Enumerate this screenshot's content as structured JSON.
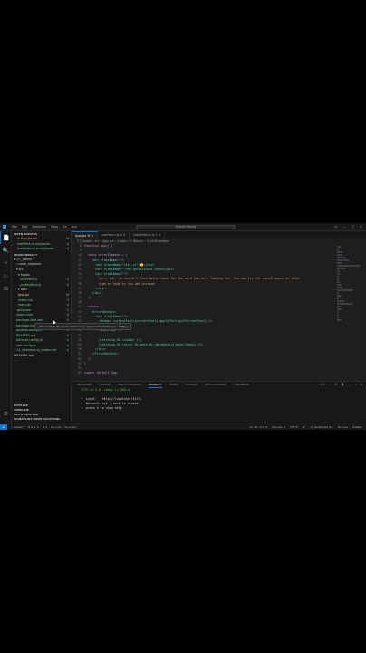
{
  "faint_lines": [
    "App.jsx M",
    "useFetch.js 3 U",
    "useKeybind.js U"
  ],
  "titlebar": {
    "menu": [
      "File",
      "Edit",
      "Selection",
      "View",
      "Go",
      "Run",
      "..."
    ],
    "search": "ShadcnReact",
    "window_controls": [
      "▭",
      "—",
      "□",
      "✕"
    ]
  },
  "activity": [
    "📄",
    "🔍",
    "⑂",
    "▷",
    "⊞",
    "⚙"
  ],
  "sidebar": {
    "open_editors_label": "OPEN EDITORS",
    "open_editors": [
      {
        "name": "✕ App.jsx src",
        "status": "M"
      },
      {
        "name": "useFetch.js src/hooks",
        "status": "U"
      },
      {
        "name": "useKeybind.js src/hooks",
        "status": "U"
      }
    ],
    "project_label": "SHADCNREACT",
    "tree": [
      {
        "name": "▾ 27_hooks",
        "status": ""
      },
      {
        "name": "› node_modules",
        "status": ""
      },
      {
        "name": "▾ src",
        "status": ""
      },
      {
        "name": "▾ hooks",
        "status": ""
      },
      {
        "name": "useFetch.js",
        "status": "U"
      },
      {
        "name": "useKeybind.js",
        "status": "U"
      },
      {
        "name": "▾ utils",
        "status": ""
      },
      {
        "name": "App.jsx",
        "status": "M"
      },
      {
        "name": "index.css",
        "status": "U"
      },
      {
        "name": "main.jsx",
        "status": "U"
      },
      {
        "name": ".gitignore",
        "status": "U"
      },
      {
        "name": "index.html",
        "status": "U"
      },
      {
        "name": "package-lock.json",
        "status": "U"
      },
      {
        "name": "package.json",
        "status": "U"
      },
      {
        "name": "postcss.config.js",
        "status": "U"
      },
      {
        "name": "README.md",
        "status": "U"
      },
      {
        "name": "tailwind.config.js",
        "status": "U"
      },
      {
        "name": "vite.config.js",
        "status": "U"
      },
      {
        "name": "› 11_introducing_hooks.md",
        "status": "U"
      },
      {
        "name": "README.md",
        "status": ""
      }
    ],
    "footer_sections": [
      "OUTLINE",
      "TIMELINE",
      "AUTO REACTOR",
      "SONARLINT ISSUE LOCATIONS"
    ]
  },
  "tabs": [
    {
      "label": "App.jsx M ✕",
      "active": true
    },
    {
      "label": "useFetch.js 3 U",
      "active": false
    },
    {
      "label": "useKeybind.js 1 U",
      "active": false
    }
  ],
  "breadcrumb": "27_hooks › src › App.jsx › ⊙ App › ⊙ Return › ⊙ clickHandler",
  "code_lines": [
    "function App() {",
    "",
    "  const errorElement = (",
    "    <div className=\"\">",
    "      <div className=\"text-xl\">😕</div>",
    "      <div className=\"\">No Definitions Found</div>",
    "      <div className=\"\">",
    "        Sorry pal, we couldn't find definitions for the word you were looking for. You can try the search again at later",
    "        time or head to the web instead.",
    "      </div>",
    "    </div>",
    "  );",
    "",
    "  return (",
    "    <ErrorHandler>",
    "      <div className=\"\">",
    "        <Header currentFont={currentFont} applyFont={setCurrentFont} />",
    "",
    "        <SearchBar />",
    "",
    "        {fetching && <Loader />}",
    "        {fetching && !error && data && <WordResult data={data} />}",
    "      </div>",
    "    </ErrorHandler>",
    "  );",
    "}",
    "",
    "export default App"
  ],
  "line_numbers_start": 8,
  "hover_tooltip": "~/Documents/27_hooks/dictionary-app/src/utils/dictionary-config.js",
  "panel": {
    "tabs": [
      "PROBLEMS",
      "OUTPUT",
      "DEBUG CONSOLE",
      "TERMINAL",
      "PORTS",
      "GITLENS",
      "SEARCH ERROR",
      "COMMENTS"
    ],
    "active_tab": "TERMINAL",
    "controls": [
      "node",
      "+",
      "⊞",
      "🗑",
      "…",
      "^",
      "✕"
    ],
    "lines": [
      "VITE v4.3.9  ready in 388 ms",
      "",
      "➜  Local:   http://localhost:5173/",
      "➜  Network: use --host to expose",
      "➜  press h to show help"
    ]
  },
  "statusbar": {
    "remote": "⋈",
    "left": [
      "⑂ master*",
      "⊗ 0 ⚠ 0",
      "⊕ 0",
      "Go Live",
      "Sourcery"
    ],
    "right": [
      "Ln 16, Col 25",
      "Spaces: 2",
      "UTF-8",
      "LF",
      "{} JavaScript JSX",
      "Go Live",
      "Prettier"
    ]
  }
}
